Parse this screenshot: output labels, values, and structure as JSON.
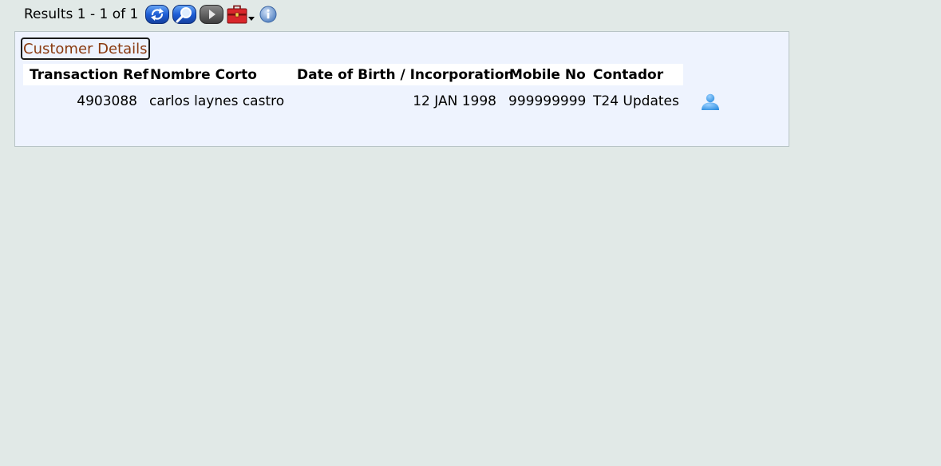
{
  "toolbar": {
    "results_text": "Results 1 - 1 of 1",
    "buttons": [
      {
        "name": "refresh",
        "icon": "refresh-icon"
      },
      {
        "name": "search",
        "icon": "magnifier-icon"
      },
      {
        "name": "next",
        "icon": "play-arrow-icon"
      },
      {
        "name": "tools",
        "icon": "toolbox-dropdown-icon"
      },
      {
        "name": "info",
        "icon": "info-icon"
      }
    ]
  },
  "panel": {
    "title": "Customer Details",
    "columns": [
      "Transaction Ref",
      "Nombre Corto",
      "Date of Birth / Incorporation",
      "Mobile No",
      "Contador"
    ],
    "rows": [
      {
        "transaction_ref": "4903088",
        "nombre_corto": "carlos laynes castro",
        "date_of_birth": "12 JAN 1998",
        "mobile_no": "999999999",
        "contador": "T24 Updates",
        "action_icon": "user-icon"
      }
    ]
  },
  "colors": {
    "page_background": "#e1e9e7",
    "panel_background": "#eef3fe",
    "title_text": "#8a3a10",
    "header_background": "#ffffff"
  }
}
